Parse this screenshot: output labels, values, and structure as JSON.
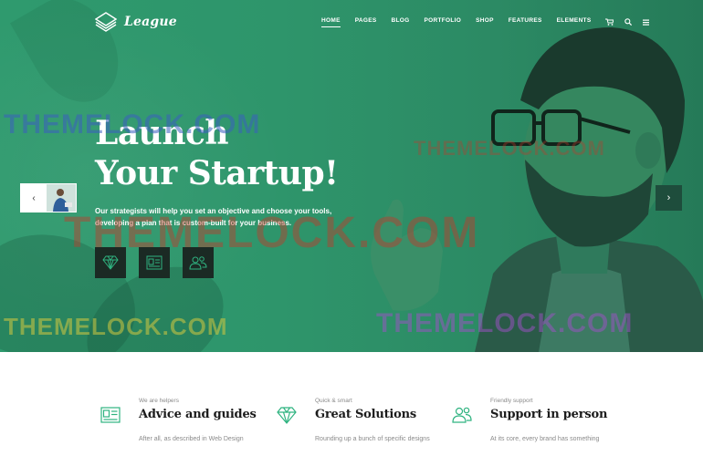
{
  "brand": {
    "name": "League",
    "logo_icon": "stacked-diamond-logo-icon"
  },
  "nav": {
    "items": [
      {
        "label": "HOME",
        "active": true
      },
      {
        "label": "PAGES",
        "active": false
      },
      {
        "label": "BLOG",
        "active": false
      },
      {
        "label": "PORTFOLIO",
        "active": false
      },
      {
        "label": "SHOP",
        "active": false
      },
      {
        "label": "FEATURES",
        "active": false
      },
      {
        "label": "ELEMENTS",
        "active": false
      }
    ],
    "cart_icon": "cart-icon",
    "search_icon": "search-icon",
    "menu_icon": "hamburger-menu-icon"
  },
  "hero": {
    "headline_line1": "Launch",
    "headline_line2": "Your Startup!",
    "subtext_line1": "Our strategists will help you set an objective and choose your tools,",
    "subtext_line2": "developing a plan that is custom-built for your business.",
    "feature_icons": [
      "diamond-icon",
      "id-card-icon",
      "users-icon"
    ],
    "prev_arrow": "‹",
    "next_arrow": "›"
  },
  "watermark": "THEMELOCK.COM",
  "features": [
    {
      "eyebrow": "We are helpers",
      "title": "Advice and guides",
      "desc": "After all, as described in Web Design",
      "icon": "id-card-icon"
    },
    {
      "eyebrow": "Quick & smart",
      "title": "Great Solutions",
      "desc": "Rounding up a bunch of specific designs",
      "icon": "diamond-icon"
    },
    {
      "eyebrow": "Friendly support",
      "title": "Support in person",
      "desc": "At its core, every brand has something",
      "icon": "users-icon"
    }
  ],
  "colors": {
    "hero_green": "#2e956b",
    "accent_green": "#2fb380",
    "icon_box": "#1b2a24",
    "watermark_blue": "#3a5fbf",
    "watermark_red": "#c0392b",
    "watermark_purple": "#a050c8",
    "watermark_yellow": "#d4c840"
  }
}
